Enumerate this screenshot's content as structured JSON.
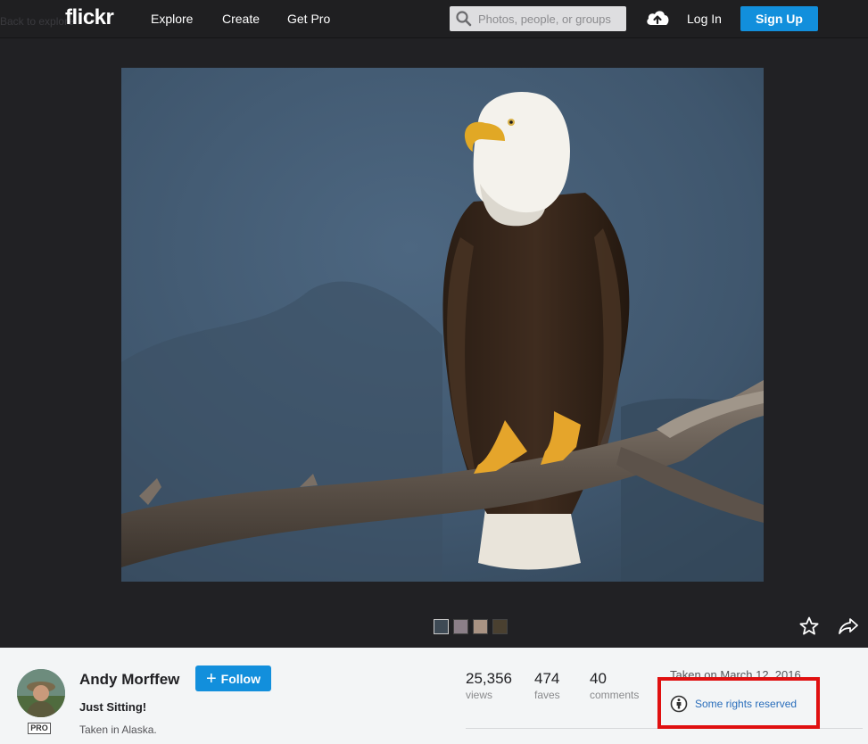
{
  "header": {
    "back_link": "Back to explore",
    "logo": "flickr",
    "nav": [
      "Explore",
      "Create",
      "Get Pro"
    ],
    "search_placeholder": "Photos, people, or groups",
    "login": "Log In",
    "signup": "Sign Up"
  },
  "photo": {
    "alt": "Bald eagle perched on a dead branch"
  },
  "owner": {
    "name": "Andy Morffew",
    "badge": "PRO",
    "follow_label": "Follow"
  },
  "details": {
    "title": "Just Sitting!",
    "description": "Taken in Alaska."
  },
  "stats": [
    {
      "value": "25,356",
      "label": "views"
    },
    {
      "value": "474",
      "label": "faves"
    },
    {
      "value": "40",
      "label": "comments"
    }
  ],
  "taken": "Taken on March 12, 2016",
  "license": {
    "label": "Some rights reserved"
  },
  "colors": {
    "accent": "#128fdc",
    "highlight": "#e01010",
    "link": "#2a6ebb"
  }
}
